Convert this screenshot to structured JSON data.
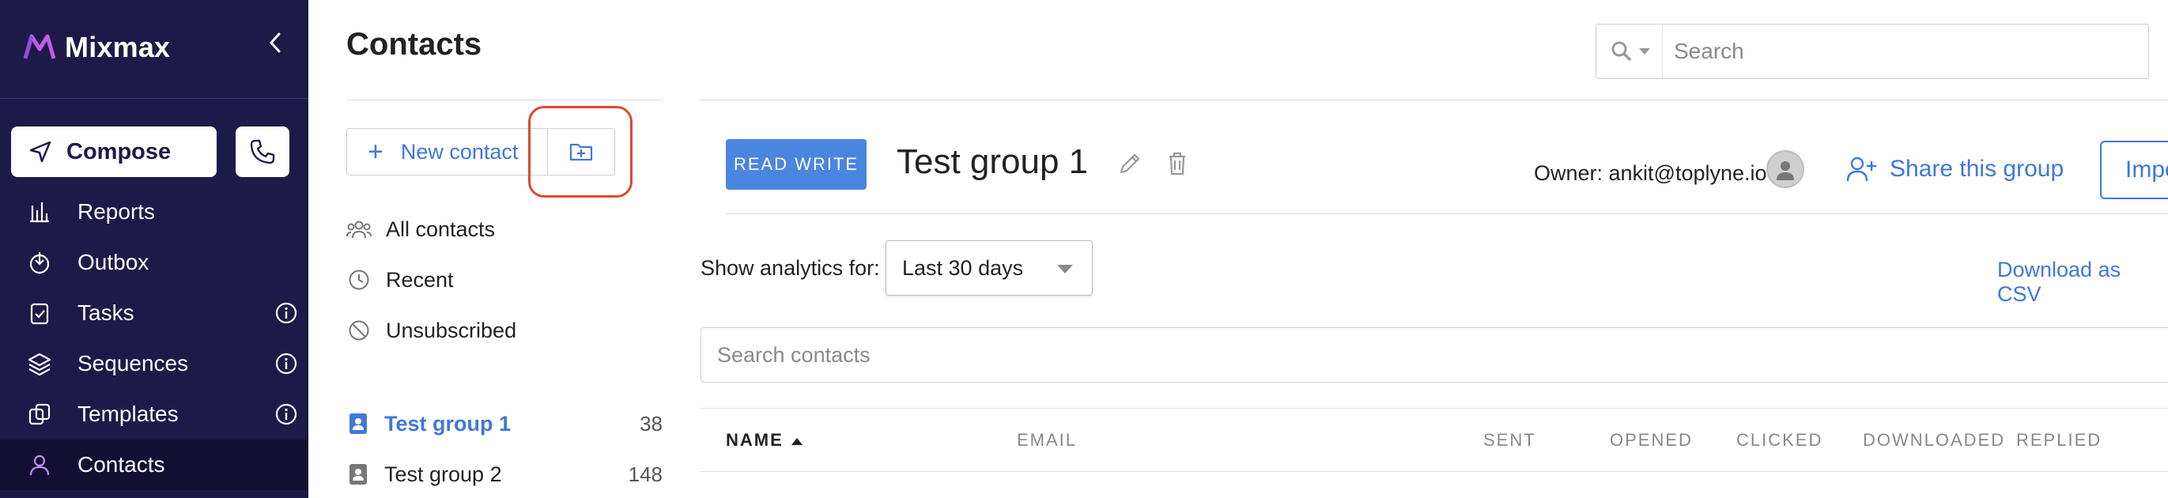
{
  "sidebar": {
    "brand": "Mixmax",
    "compose_label": "Compose",
    "items": [
      {
        "label": "Reports",
        "icon": "reports-icon"
      },
      {
        "label": "Outbox",
        "icon": "outbox-icon"
      },
      {
        "label": "Tasks",
        "icon": "tasks-icon"
      },
      {
        "label": "Sequences",
        "icon": "sequences-icon"
      },
      {
        "label": "Templates",
        "icon": "templates-icon"
      },
      {
        "label": "Contacts",
        "icon": "contacts-icon"
      }
    ]
  },
  "main": {
    "title": "Contacts",
    "new_contact_label": "New contact",
    "filters": [
      "All contacts",
      "Recent",
      "Unsubscribed"
    ],
    "groups": [
      {
        "name": "Test group 1",
        "count": "38"
      },
      {
        "name": "Test group 2",
        "count": "148"
      }
    ]
  },
  "search": {
    "placeholder": "Search"
  },
  "group": {
    "badge": "READ WRITE",
    "title": "Test group 1",
    "owner": "Owner: ankit@toplyne.io",
    "share_label": "Share this group",
    "import_label": "Impo"
  },
  "analytics": {
    "label": "Show analytics for:",
    "selected": "Last 30 days",
    "csv_label": "Download as CSV"
  },
  "contacts_search": {
    "placeholder": "Search contacts"
  },
  "table": {
    "columns": [
      "NAME",
      "EMAIL",
      "SENT",
      "OPENED",
      "CLICKED",
      "DOWNLOADED",
      "REPLIED"
    ]
  },
  "colors": {
    "sidebar_bg": "#1d1a4a",
    "accent": "#3f78d9",
    "badge": "#4a85e0",
    "highlight": "#e0482f"
  }
}
